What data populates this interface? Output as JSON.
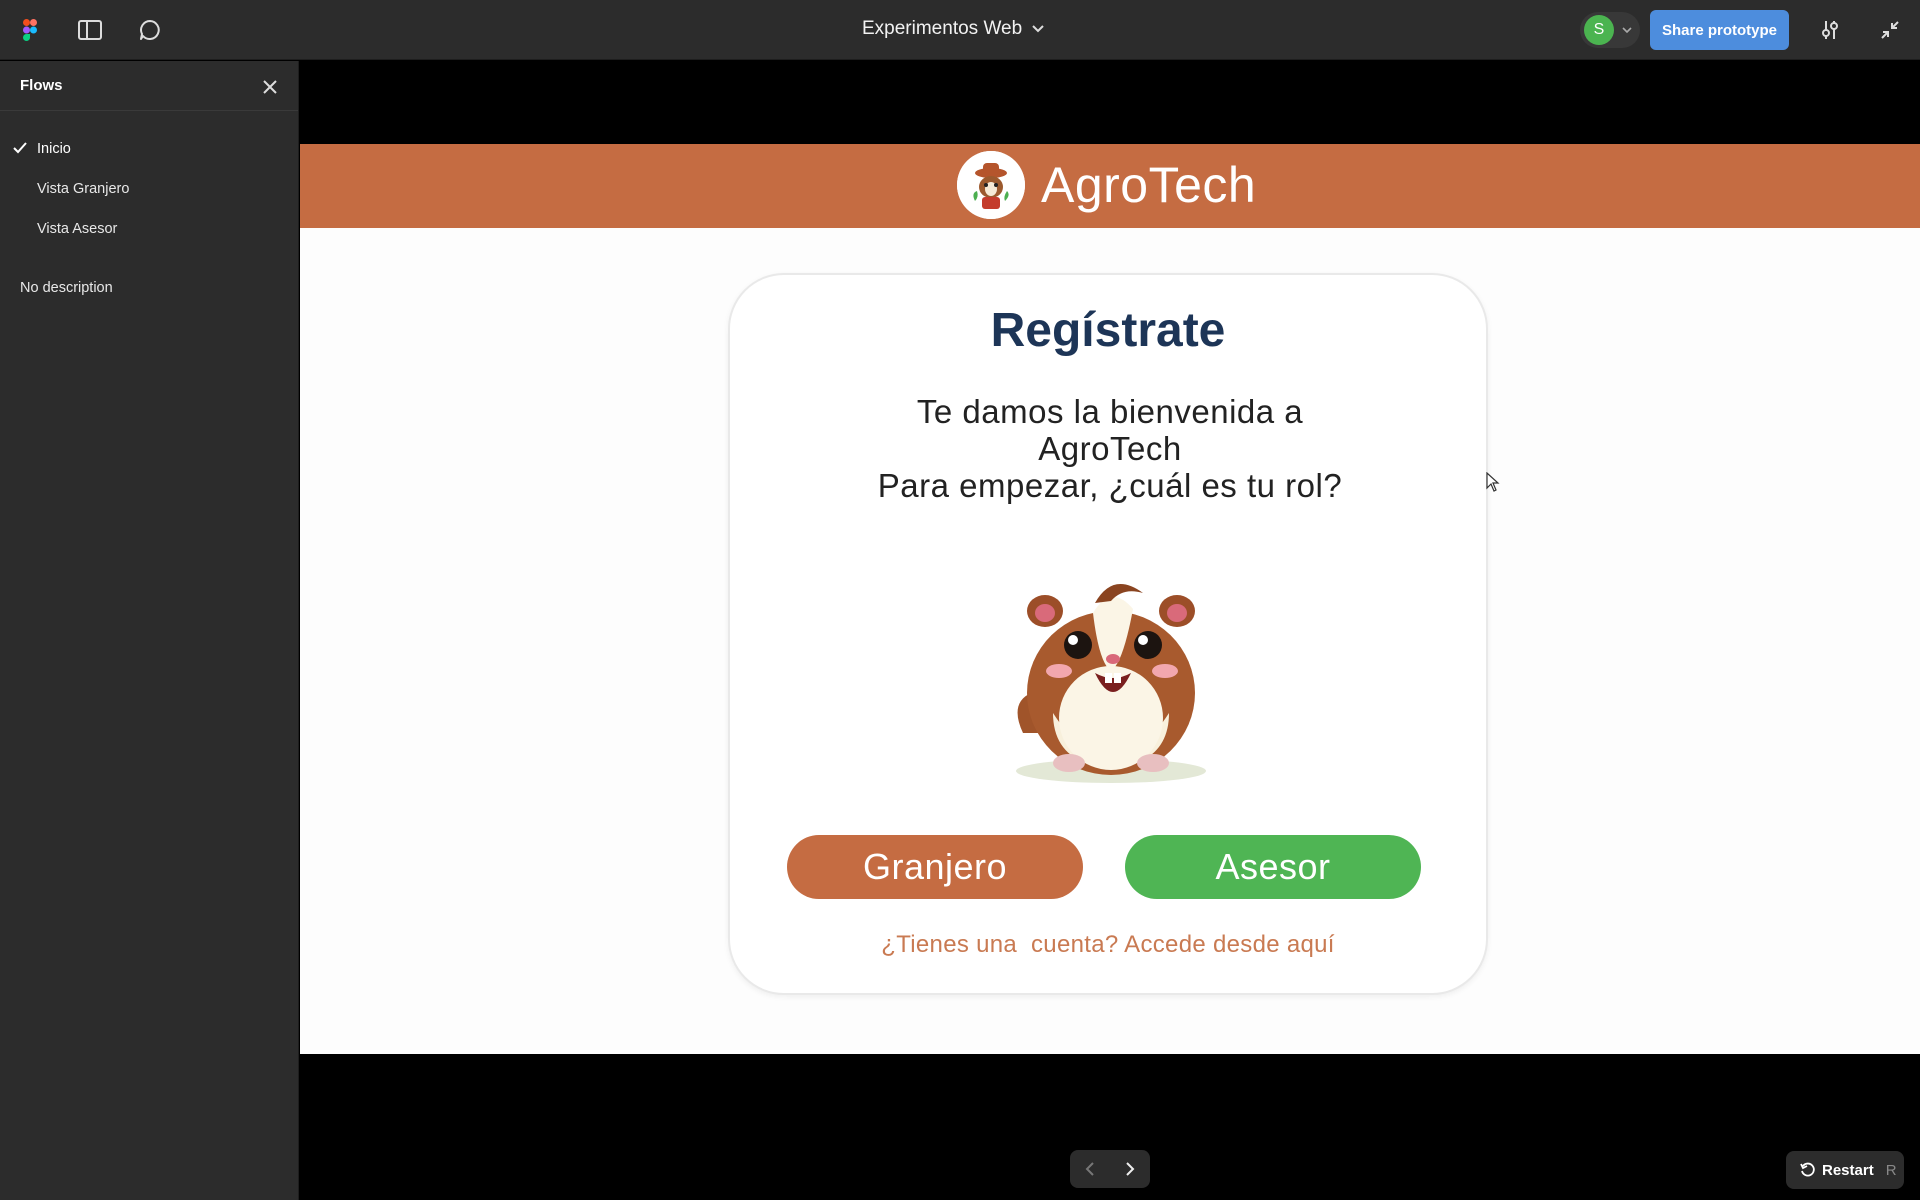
{
  "topbar": {
    "file_title": "Experimentos Web",
    "avatar_initial": "S",
    "share_label": "Share prototype"
  },
  "sidebar": {
    "title": "Flows",
    "items": [
      {
        "label": "Inicio",
        "active": true
      },
      {
        "label": "Vista Granjero",
        "active": false
      },
      {
        "label": "Vista Asesor",
        "active": false
      }
    ],
    "description": "No description"
  },
  "prototype": {
    "brand": "AgroTech",
    "card": {
      "title": "Regístrate",
      "subtitle_lines": [
        "Te damos la bienvenida a",
        "AgroTech",
        "Para empezar, ¿cuál es tu rol?"
      ],
      "button_granjero": "Granjero",
      "button_asesor": "Asesor",
      "login_link": "¿Tienes una  cuenta? Accede desde aquí"
    }
  },
  "controls": {
    "restart_label": "Restart",
    "restart_shortcut": "R"
  },
  "colors": {
    "brand_orange": "#c56c42",
    "brand_green": "#4fb554",
    "title_navy": "#1d3557",
    "share_blue": "#4d8ddd"
  },
  "icons": [
    "figma-logo-icon",
    "sidebar-toggle-icon",
    "comment-icon",
    "chevron-down-icon",
    "settings-sliders-icon",
    "collapse-icon",
    "close-icon",
    "check-icon",
    "chevron-left-icon",
    "chevron-right-icon",
    "restart-icon"
  ]
}
